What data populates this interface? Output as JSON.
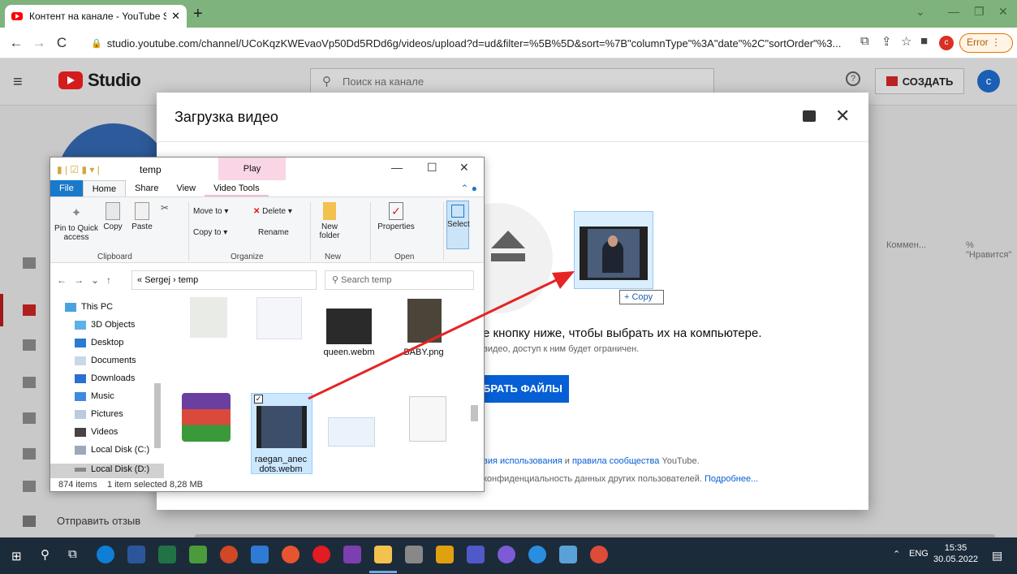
{
  "browser": {
    "tab_title": "Контент на канале - YouTube St",
    "url": "studio.youtube.com/channel/UCoKqzKWEvaoVp50Dd5RDd6g/videos/upload?d=ud&filter=%5B%5D&sort=%7B\"columnType\"%3A\"date\"%2C\"sortOrder\"%3...",
    "profile_initial": "c",
    "error_label": "Error"
  },
  "studio": {
    "logo_text": "Studio",
    "search_placeholder": "Поиск на канале",
    "create_label": "СОЗДАТЬ",
    "avatar_initial": "c",
    "feedback_label": "Отправить отзыв",
    "col_comments": "Коммен...",
    "col_likes": "% \"Нравится\""
  },
  "upload_dialog": {
    "title": "Загрузка видео",
    "main_text": "е кнопку ниже, чтобы выбрать их на компьютере.",
    "sub_text": "видео, доступ к ним будет ограничен.",
    "select_button": "БРАТЬ ФАЙЛЫ",
    "terms_prefix": "вия использования",
    "terms_and": " и ",
    "terms_link2": "правила сообщества",
    "terms_suffix": " YouTube.",
    "privacy_prefix": "конфиденциальность данных других пользователей. ",
    "privacy_link": "Подробнее..."
  },
  "drag": {
    "copy_tooltip": "+ Copy"
  },
  "explorer": {
    "title": "temp",
    "context_tab": "Play",
    "tabs": [
      "File",
      "Home",
      "Share",
      "View",
      "Video Tools"
    ],
    "ribbon": {
      "pin": "Pin to Quick access",
      "copy": "Copy",
      "paste": "Paste",
      "move_to": "Move to",
      "delete": "Delete",
      "copy_to": "Copy to",
      "rename": "Rename",
      "new_folder": "New folder",
      "properties": "Properties",
      "select": "Select",
      "groups": [
        "Clipboard",
        "Organize",
        "New",
        "Open"
      ]
    },
    "breadcrumb": [
      "Sergej",
      "temp"
    ],
    "search_placeholder": "Search temp",
    "nav_items": [
      "This PC",
      "3D Objects",
      "Desktop",
      "Documents",
      "Downloads",
      "Music",
      "Pictures",
      "Videos",
      "Local Disk (C:)",
      "Local Disk (D:)"
    ],
    "files": {
      "queen": "queen.webm",
      "baby": "BABY.png",
      "raegan_line1": "raegan_anec",
      "raegan_line2": "dots.webm"
    },
    "status": {
      "items": "874 items",
      "selected": "1 item selected 8,28 MB"
    }
  },
  "taskbar": {
    "lang": "ENG",
    "time": "15:35",
    "date": "30.05.2022"
  }
}
